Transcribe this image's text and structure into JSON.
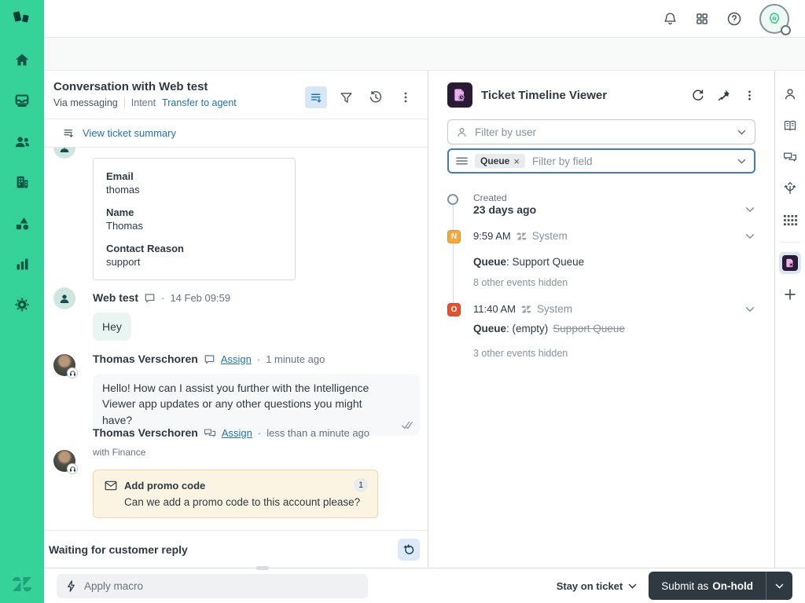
{
  "ui": {
    "dot": "·",
    "colon": ":"
  },
  "colors": {
    "nav_green": "#35D399",
    "accent_blue": "#1F73B7",
    "dark": "#2F3941",
    "badge_new": "#F5A93C",
    "badge_open": "#E8502F",
    "app_purple": "#2B1A33",
    "app_pink": "#EBB0F0"
  },
  "topbar": {
    "icons": [
      "bell-icon",
      "grid-icon",
      "help-icon",
      "avatar"
    ]
  },
  "left_nav": {
    "icons": [
      "home-icon",
      "views-icon",
      "customers-icon",
      "organizations-icon",
      "objects-icon",
      "reporting-icon",
      "admin-icon"
    ]
  },
  "conversation": {
    "title": "Conversation with Web test",
    "channel": "Via messaging",
    "intent_label": "Intent",
    "intent_link": "Transfer to agent",
    "summary_link": "View ticket summary",
    "ticket_fields": [
      {
        "label": "Email",
        "value": "thomas"
      },
      {
        "label": "Name",
        "value": "Thomas"
      },
      {
        "label": "Contact Reason",
        "value": "support"
      }
    ],
    "messages": [
      {
        "author": "Web test",
        "time": "14 Feb 09:59",
        "text": "Hey"
      },
      {
        "author": "Thomas Verschoren",
        "action": "Assign",
        "time": "1 minute ago",
        "text": "Hello! How can I assist you further with the Intelligence Viewer app updates or any other questions you might have?"
      },
      {
        "author": "Thomas Verschoren",
        "action": "Assign",
        "time": "less than a minute ago",
        "context": "with Finance",
        "card": {
          "title": "Add promo code",
          "badge": "1",
          "body": "Can we add a promo code to this account please?"
        }
      }
    ],
    "status_text": "Waiting for customer reply"
  },
  "app_panel": {
    "title": "Ticket Timeline Viewer",
    "filters": {
      "user_placeholder": "Filter by user",
      "field_tag": "Queue",
      "field_placeholder": "Filter by field"
    },
    "timeline": {
      "created": {
        "label": "Created",
        "time": "23 days ago"
      },
      "events": [
        {
          "badge": "N",
          "time": "9:59 AM",
          "actor": "System",
          "field": "Queue",
          "value": " Support Queue",
          "hidden": "8 other events hidden"
        },
        {
          "badge": "O",
          "time": "11:40 AM",
          "actor": "System",
          "field": "Queue",
          "value": " (empty)",
          "removed": "Support Queue",
          "hidden": "3 other events hidden"
        }
      ]
    }
  },
  "footer": {
    "macro_placeholder": "Apply macro",
    "stay_label": "Stay on ticket",
    "submit_prefix": "Submit as",
    "submit_status": "On-hold"
  }
}
